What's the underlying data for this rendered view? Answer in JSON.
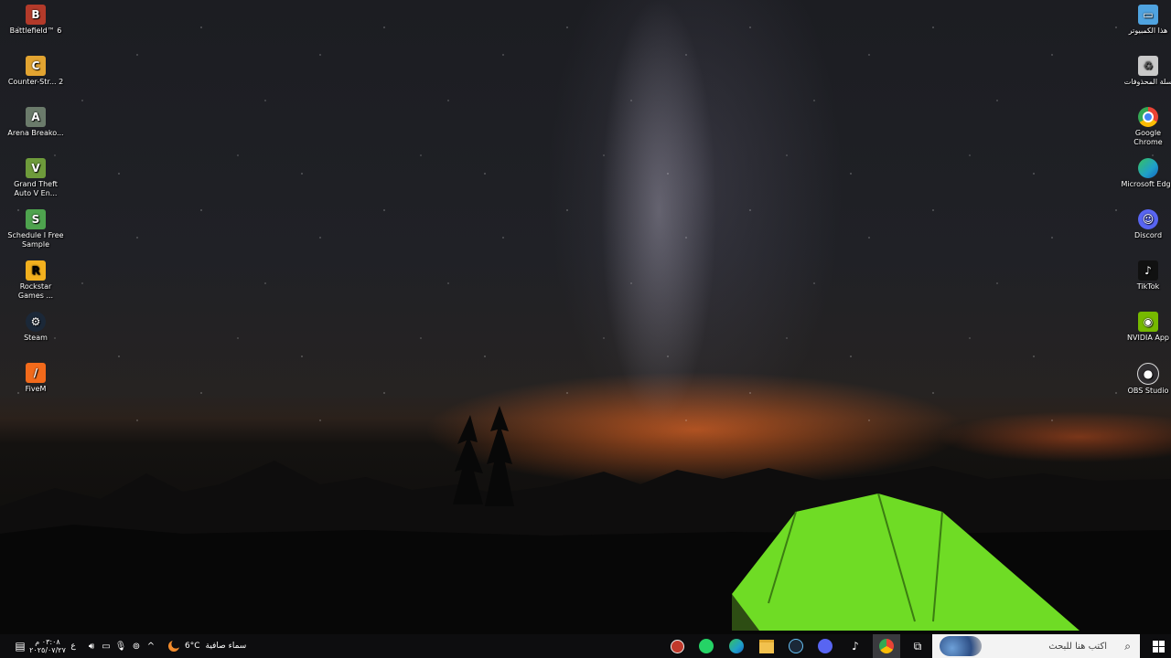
{
  "desktop": {
    "left_icons": [
      {
        "label": "Battlefield™ 6",
        "icon": "battlefield-icon",
        "color": "#b33a2a"
      },
      {
        "label": "Counter-Str... 2",
        "icon": "counter-strike-icon",
        "color": "#e2a431"
      },
      {
        "label": "Arena Breako...",
        "icon": "arena-breakout-icon",
        "color": "#6b7b6b"
      },
      {
        "label": "Grand Theft Auto V En...",
        "icon": "gta-v-icon",
        "color": "#6e9b3b"
      },
      {
        "label": "Schedule I Free Sample",
        "icon": "schedule-i-icon",
        "color": "#4ea34e"
      },
      {
        "label": "Rockstar Games ...",
        "icon": "rockstar-icon",
        "color": "#f2b01e"
      },
      {
        "label": "Steam",
        "icon": "steam-icon",
        "color": "#1b2838"
      },
      {
        "label": "FiveM",
        "icon": "fivem-icon",
        "color": "#f26a1b"
      }
    ],
    "right_icons": [
      {
        "label": "هذا الكمبيوتر",
        "icon": "this-pc-icon",
        "color": "#4fa3e0"
      },
      {
        "label": "سلة المحذوفات",
        "icon": "recycle-bin-icon",
        "color": "#c9c9c9"
      },
      {
        "label": "Google Chrome",
        "icon": "chrome-icon",
        "color": "#4285f4"
      },
      {
        "label": "Microsoft Edge",
        "icon": "edge-icon",
        "color": "#1fa0c9"
      },
      {
        "label": "Discord",
        "icon": "discord-icon",
        "color": "#5865f2"
      },
      {
        "label": "TikTok",
        "icon": "tiktok-icon",
        "color": "#111111"
      },
      {
        "label": "NVIDIA App",
        "icon": "nvidia-icon",
        "color": "#76b900"
      },
      {
        "label": "OBS Studio",
        "icon": "obs-icon",
        "color": "#302e31"
      }
    ]
  },
  "taskbar": {
    "search_placeholder": "اكتب هنا للبحث",
    "weather_temp": "6°C",
    "weather_text": "سماء صافية",
    "time": "٠٣:٠٨ م",
    "date": "٢٠٢٥/٠٧/٢٧",
    "language": "ع",
    "apps": [
      {
        "icon": "task-view-icon"
      },
      {
        "icon": "chrome-icon",
        "color": "#4285f4",
        "active": true
      },
      {
        "icon": "tiktok-icon",
        "color": "#111111"
      },
      {
        "icon": "discord-icon",
        "color": "#5865f2"
      },
      {
        "icon": "steam-icon",
        "color": "#1b2838"
      },
      {
        "icon": "file-explorer-icon",
        "color": "#f2c14e"
      },
      {
        "icon": "edge-icon",
        "color": "#1fa0c9"
      },
      {
        "icon": "whatsapp-icon",
        "color": "#25d366"
      },
      {
        "icon": "app-icon",
        "color": "#c0392b"
      }
    ]
  }
}
